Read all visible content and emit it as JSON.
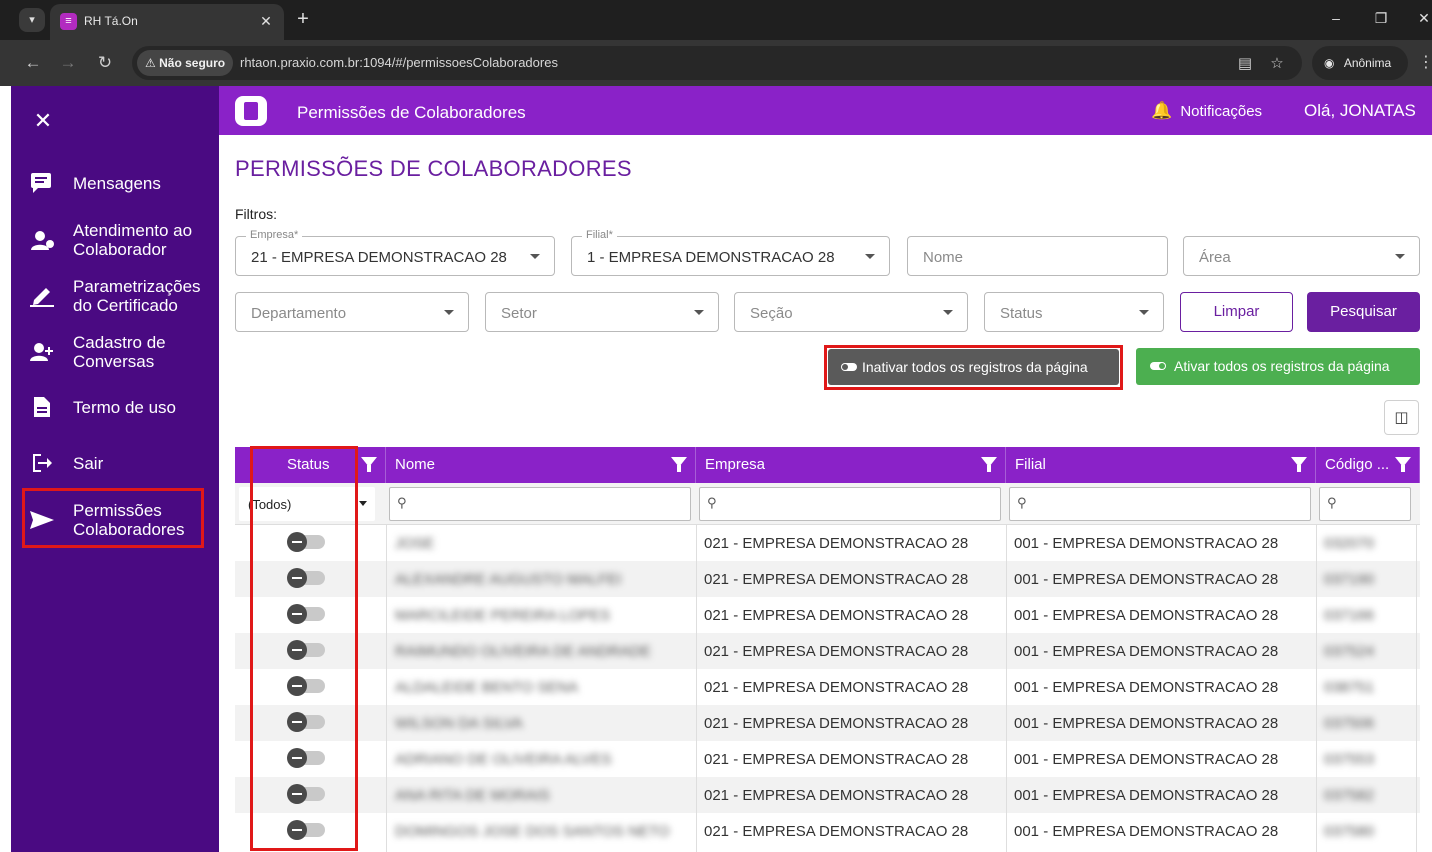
{
  "browser": {
    "tab_title": "RH Tá.On",
    "security_label": "Não seguro",
    "url": "rhtaon.praxio.com.br:1094/#/permissoesColaboradores",
    "incognito_label": "Anônima"
  },
  "sidebar": {
    "items": [
      {
        "label": "Mensagens",
        "icon": "message-icon"
      },
      {
        "label": "Atendimento ao\nColaborador",
        "icon": "support-user-icon"
      },
      {
        "label": "Parametrizações\ndo Certificado",
        "icon": "edit-pen-icon"
      },
      {
        "label": "Cadastro de\nConversas",
        "icon": "person-add-icon"
      },
      {
        "label": "Termo de uso",
        "icon": "document-icon"
      },
      {
        "label": "Sair",
        "icon": "logout-icon"
      },
      {
        "label": "Permissões\nColaboradores",
        "icon": "send-icon"
      }
    ]
  },
  "header": {
    "title": "Permissões de Colaboradores",
    "notifications": "Notificações",
    "greeting": "Olá, JONATAS"
  },
  "page": {
    "title": "PERMISSÕES DE COLABORADORES",
    "filters_label": "Filtros:"
  },
  "filters": {
    "empresa": {
      "legend": "Empresa*",
      "value": "21 - EMPRESA DEMONSTRACAO 28"
    },
    "filial": {
      "legend": "Filial*",
      "value": "1 - EMPRESA DEMONSTRACAO 28"
    },
    "nome": {
      "placeholder": "Nome"
    },
    "area": {
      "placeholder": "Área"
    },
    "departamento": {
      "placeholder": "Departamento"
    },
    "setor": {
      "placeholder": "Setor"
    },
    "secao": {
      "placeholder": "Seção"
    },
    "status": {
      "placeholder": "Status"
    },
    "clear_label": "Limpar",
    "search_label": "Pesquisar"
  },
  "actions": {
    "inactivate_all": "Inativar todos os registros da página",
    "activate_all": "Ativar todos os registros da página"
  },
  "grid": {
    "columns": [
      "Status",
      "Nome",
      "Empresa",
      "Filial",
      "Código ..."
    ],
    "status_filter_value": "(Todos)",
    "rows": [
      {
        "nome": "JOSE",
        "empresa": "021 - EMPRESA DEMONSTRACAO 28",
        "filial": "001 - EMPRESA DEMONSTRACAO 28",
        "codigo": "032070"
      },
      {
        "nome": "ALEXANDRE AUGUSTO MALFEI",
        "empresa": "021 - EMPRESA DEMONSTRACAO 28",
        "filial": "001 - EMPRESA DEMONSTRACAO 28",
        "codigo": "037190"
      },
      {
        "nome": "MARCILEIDE PEREIRA LOPES",
        "empresa": "021 - EMPRESA DEMONSTRACAO 28",
        "filial": "001 - EMPRESA DEMONSTRACAO 28",
        "codigo": "037166"
      },
      {
        "nome": "RAIMUNDO OLIVEIRA DE ANDRADE",
        "empresa": "021 - EMPRESA DEMONSTRACAO 28",
        "filial": "001 - EMPRESA DEMONSTRACAO 28",
        "codigo": "037524"
      },
      {
        "nome": "ALDALEIDE BENTO SENA",
        "empresa": "021 - EMPRESA DEMONSTRACAO 28",
        "filial": "001 - EMPRESA DEMONSTRACAO 28",
        "codigo": "038751"
      },
      {
        "nome": "WILSON DA SILVA",
        "empresa": "021 - EMPRESA DEMONSTRACAO 28",
        "filial": "001 - EMPRESA DEMONSTRACAO 28",
        "codigo": "037506"
      },
      {
        "nome": "ADRIANO DE OLIVEIRA ALVES",
        "empresa": "021 - EMPRESA DEMONSTRACAO 28",
        "filial": "001 - EMPRESA DEMONSTRACAO 28",
        "codigo": "037553"
      },
      {
        "nome": "ANA RITA DE MORAIS",
        "empresa": "021 - EMPRESA DEMONSTRACAO 28",
        "filial": "001 - EMPRESA DEMONSTRACAO 28",
        "codigo": "037582"
      },
      {
        "nome": "DOMINGOS JOSE DOS SANTOS NETO",
        "empresa": "021 - EMPRESA DEMONSTRACAO 28",
        "filial": "001 - EMPRESA DEMONSTRACAO 28",
        "codigo": "037580"
      }
    ]
  },
  "colors": {
    "sidebar": "#4a0a82",
    "header": "#8a22c8",
    "accent": "#6a1fa0",
    "activate": "#4caf50",
    "highlight": "#e01818"
  }
}
